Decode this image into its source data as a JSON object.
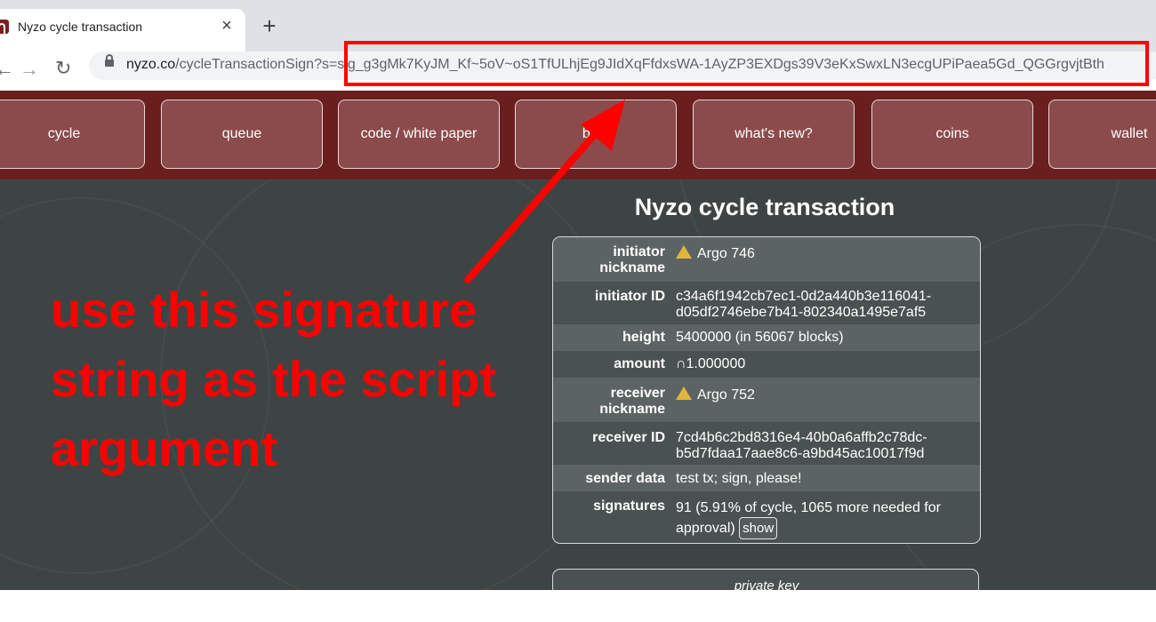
{
  "browser": {
    "tab_title": "Nyzo cycle transaction",
    "tab_close": "×",
    "new_tab": "+",
    "back": "←",
    "forward": "→",
    "reload": "↻",
    "url_host": "nyzo.co",
    "url_rest": "/cycleTransactionSign?s=sig_g3gMk7KyJM_Kf~5oV~oS1TfULhjEg9JIdXqFfdxsWA-1AyZP3EXDgs39V3eKxSwxLN3ecgUPiPaea5Gd_QGGrgvjtBth"
  },
  "nav": {
    "cycle": "cycle",
    "queue": "queue",
    "code": "code / white paper",
    "blog": "blog",
    "whats_new": "what's new?",
    "coins": "coins",
    "wallet": "wallet"
  },
  "page": {
    "title": "Nyzo cycle transaction"
  },
  "transaction": {
    "initiator_nickname_label_1": "initiator",
    "initiator_nickname_label_2": "nickname",
    "initiator_nickname": "Argo 746",
    "initiator_id_label": "initiator ID",
    "initiator_id_1": "c34a6f1942cb7ec1-0d2a440b3e116041-",
    "initiator_id_2": "d05df2746ebe7b41-802340a1495e7af5",
    "height_label": "height",
    "height": "5400000 (in 56067 blocks)",
    "amount_label": "amount",
    "amount": "∩1.000000",
    "receiver_nickname_label_1": "receiver",
    "receiver_nickname_label_2": "nickname",
    "receiver_nickname": "Argo 752",
    "receiver_id_label": "receiver ID",
    "receiver_id_1": "7cd4b6c2bd8316e4-40b0a6affb2c78dc-",
    "receiver_id_2": "b5d7fdaa17aae8c6-a9bd45ac10017f9d",
    "sender_data_label": "sender data",
    "sender_data": "test tx; sign, please!",
    "signatures_label": "signatures",
    "signatures_1": "91 (5.91% of cycle, 1065 more needed for",
    "signatures_2": "approval)",
    "show_button": "show"
  },
  "private_key": {
    "label": "private key"
  },
  "annotation": {
    "line1": "use this signature",
    "line2": "string as the script",
    "line3": "argument",
    "color": "#ff0000"
  }
}
